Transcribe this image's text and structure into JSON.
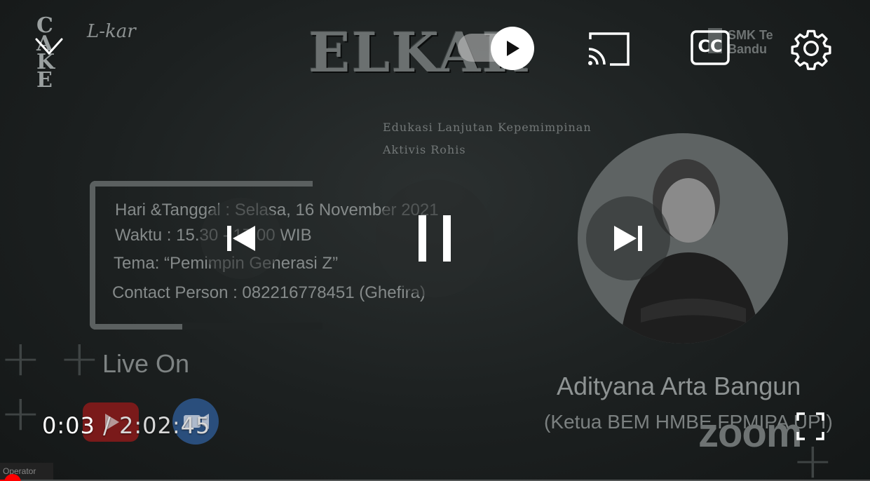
{
  "video_frame": {
    "brand_logo_text": "CAKE",
    "brand_logo_script": "L-kar",
    "title": "ELKAR",
    "subtitle_line1": "Edukasi Lanjutan Kepemimpinan",
    "subtitle_line2": "Aktivis Rohis",
    "school_logo_line1": "SMK Te",
    "school_logo_line2": "Bandu",
    "info": {
      "date": "Hari &Tanggal : Selasa, 16 November 2021",
      "time": "Waktu : 15.30 - 17.00 WIB",
      "theme": "Tema: “Pemimpin Generasi Z”",
      "contact": "Contact Person : 082216778451 (Ghefira)"
    },
    "live_on": "Live On",
    "speaker_name": "Adityana Arta Bangun",
    "speaker_role": "(Ketua BEM HMBE FPMIPA UPI)",
    "watermark": "zoom",
    "operator_label": "Operator"
  },
  "controls": {
    "current_time": "0:03",
    "separator": " / ",
    "duration": "2:02:45",
    "progress": 0.0004,
    "autoplay_on": true,
    "icons": {
      "minimize": "chevron-down-icon",
      "autoplay": "autoplay-toggle",
      "cast": "cast-icon",
      "captions": "closed-captions-icon",
      "settings": "gear-icon",
      "previous": "skip-previous-icon",
      "pause": "pause-icon",
      "next": "skip-next-icon",
      "fullscreen": "fullscreen-icon"
    },
    "captions_label": "CC"
  },
  "colors": {
    "accent": "#ff0000",
    "icon": "#ffffff"
  }
}
